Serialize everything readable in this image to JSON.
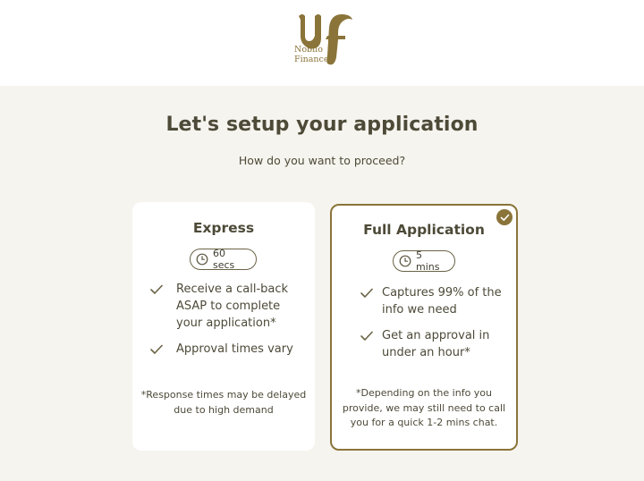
{
  "brand": {
    "name_line1": "Nobilo",
    "name_line2": "Finance",
    "accent": "#8a7439"
  },
  "page": {
    "title": "Let's setup your application",
    "subtitle": "How do you want to proceed?"
  },
  "options": [
    {
      "title": "Express",
      "duration": "60 secs",
      "features": [
        "Receive a call-back ASAP to complete your application*",
        "Approval times vary"
      ],
      "note": "*Response times may be delayed due to high demand",
      "selected": false
    },
    {
      "title": "Full Application",
      "duration": "5 mins",
      "features": [
        "Captures 99% of the info we need",
        "Get an approval in under an hour*"
      ],
      "note": "*Depending on the info you provide, we may still need to call you for a quick 1-2 mins chat.",
      "selected": true
    }
  ],
  "icons": {
    "duration": "clock-icon",
    "feature": "check-icon",
    "selected": "check-circle-icon"
  }
}
